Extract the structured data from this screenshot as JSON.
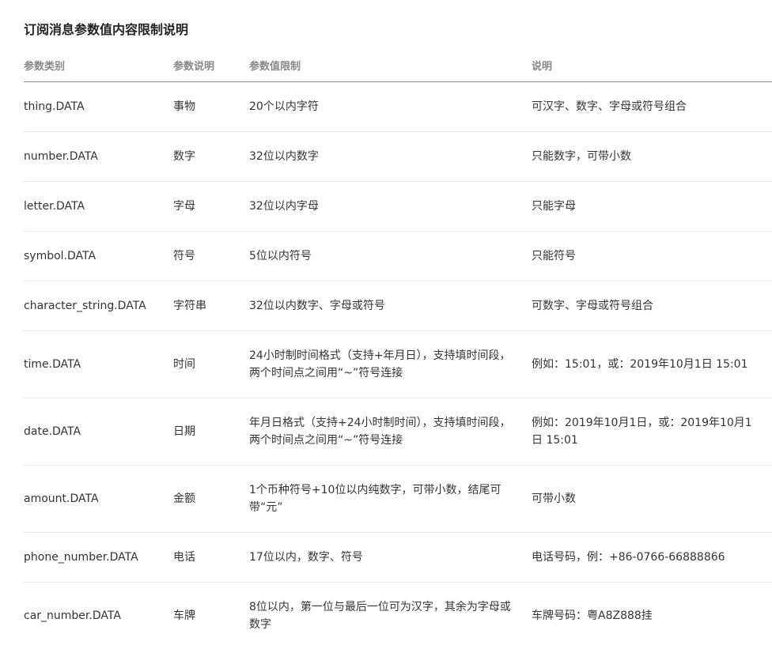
{
  "title": "订阅消息参数值内容限制说明",
  "headers": [
    "参数类别",
    "参数说明",
    "参数值限制",
    "说明"
  ],
  "rows": [
    [
      "thing.DATA",
      "事物",
      "20个以内字符",
      "可汉字、数字、字母或符号组合"
    ],
    [
      "number.DATA",
      "数字",
      "32位以内数字",
      "只能数字，可带小数"
    ],
    [
      "letter.DATA",
      "字母",
      "32位以内字母",
      "只能字母"
    ],
    [
      "symbol.DATA",
      "符号",
      "5位以内符号",
      "只能符号"
    ],
    [
      "character_string.DATA",
      "字符串",
      "32位以内数字、字母或符号",
      "可数字、字母或符号组合"
    ],
    [
      "time.DATA",
      "时间",
      "24小时制时间格式（支持+年月日），支持填时间段，两个时间点之间用“~”符号连接",
      "例如：15:01，或：2019年10月1日 15:01"
    ],
    [
      "date.DATA",
      "日期",
      "年月日格式（支持+24小时制时间），支持填时间段，两个时间点之间用“~”符号连接",
      "例如：2019年10月1日，或：2019年10月1日 15:01"
    ],
    [
      "amount.DATA",
      "金额",
      "1个币种符号+10位以内纯数字，可带小数，结尾可带“元”",
      "可带小数"
    ],
    [
      "phone_number.DATA",
      "电话",
      "17位以内，数字、符号",
      "电话号码，例：+86-0766-66888866"
    ],
    [
      "car_number.DATA",
      "车牌",
      "8位以内，第一位与最后一位可为汉字，其余为字母或数字",
      "车牌号码：粤A8Z888挂"
    ]
  ]
}
